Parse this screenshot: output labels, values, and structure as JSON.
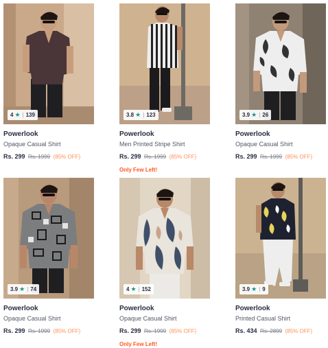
{
  "products": [
    {
      "rating": "4",
      "rating_count": "139",
      "brand": "Powerlook",
      "name": "Opaque Casual Shirt",
      "price": "Rs. 299",
      "mrp": "Rs. 1999",
      "discount": "(85% OFF)",
      "stock_note": ""
    },
    {
      "rating": "3.8",
      "rating_count": "123",
      "brand": "Powerlook",
      "name": "Men Printed Stripe Shirt",
      "price": "Rs. 299",
      "mrp": "Rs. 1999",
      "discount": "(85% OFF)",
      "stock_note": "Only Few Left!"
    },
    {
      "rating": "3.9",
      "rating_count": "26",
      "brand": "Powerlook",
      "name": "Opaque Casual Shirt",
      "price": "Rs. 299",
      "mrp": "Rs. 1999",
      "discount": "(85% OFF)",
      "stock_note": ""
    },
    {
      "rating": "3.9",
      "rating_count": "74",
      "brand": "Powerlook",
      "name": "Opaque Casual Shirt",
      "price": "Rs. 299",
      "mrp": "Rs. 1999",
      "discount": "(85% OFF)",
      "stock_note": ""
    },
    {
      "rating": "4",
      "rating_count": "152",
      "brand": "Powerlook",
      "name": "Opaque Casual Shirt",
      "price": "Rs. 299",
      "mrp": "Rs. 1999",
      "discount": "(85% OFF)",
      "stock_note": "Only Few Left!"
    },
    {
      "rating": "3.9",
      "rating_count": "9",
      "brand": "Powerlook",
      "name": "Printed Casual Shirt",
      "price": "Rs. 434",
      "mrp": "Rs. 2899",
      "discount": "(85% OFF)",
      "stock_note": ""
    }
  ],
  "icons": {
    "rating_star": "star-icon"
  },
  "colors": {
    "rating_star": "#14958f",
    "discount": "#ff905a",
    "stock_note": "#ff5722"
  }
}
